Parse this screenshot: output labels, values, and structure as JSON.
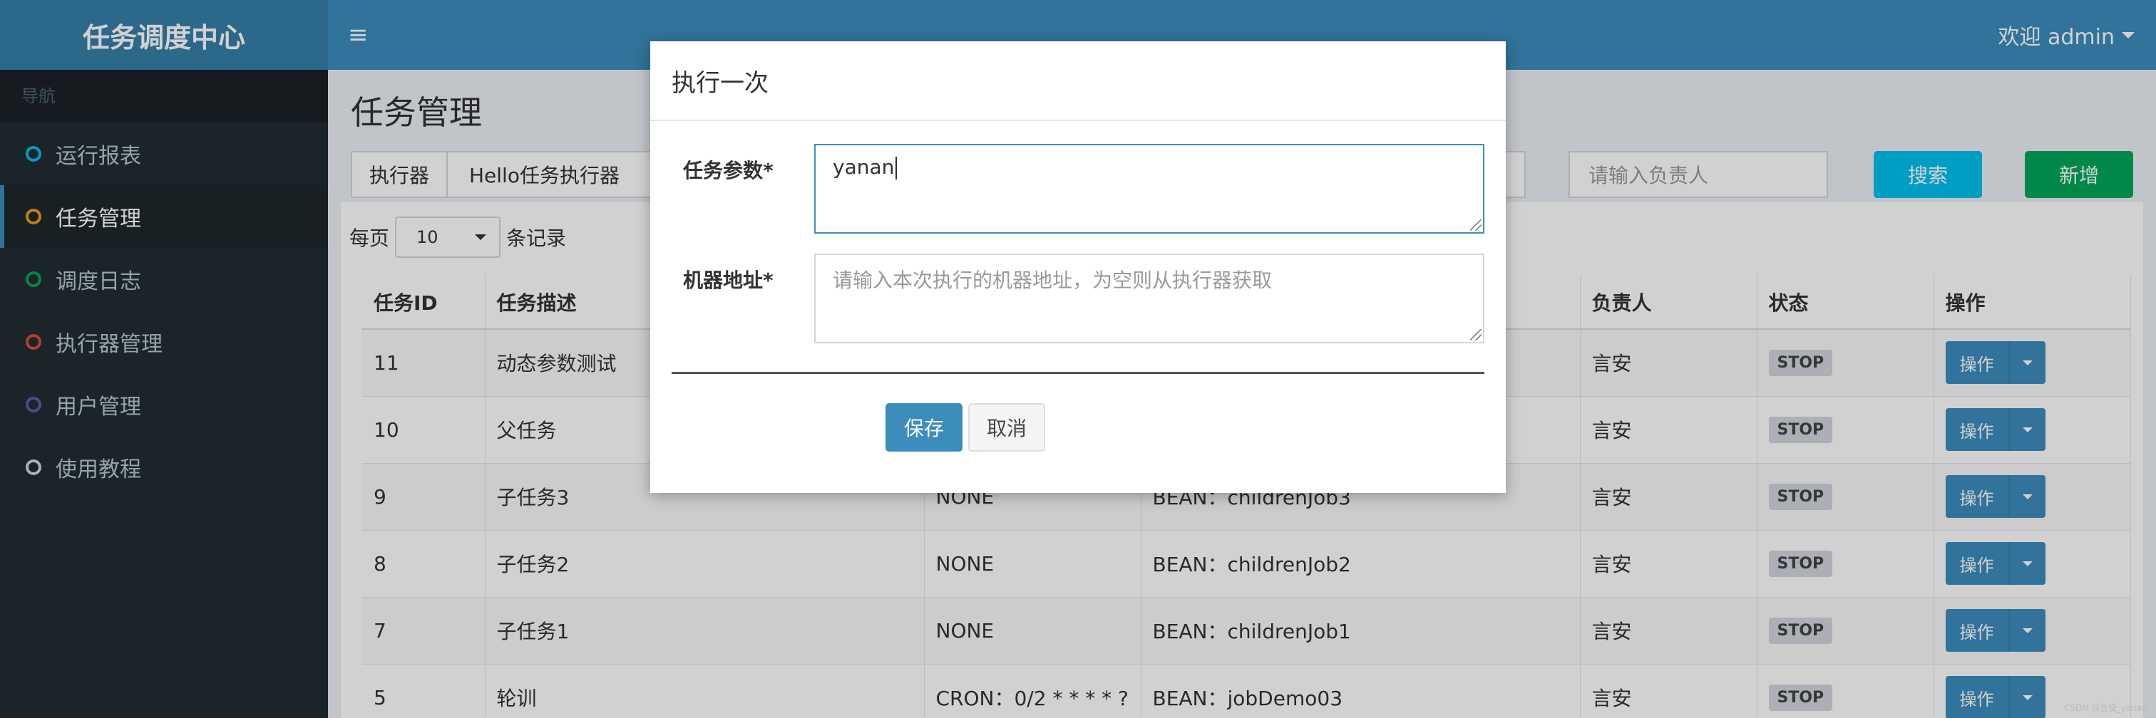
{
  "app": {
    "title": "任务调度中心",
    "hamburger": "≡",
    "user_label": "欢迎 admin"
  },
  "sidebar": {
    "header": "导航",
    "items": [
      {
        "label": "运行报表",
        "color": "#00c0ef",
        "active": false
      },
      {
        "label": "任务管理",
        "color": "#f39c12",
        "active": true
      },
      {
        "label": "调度日志",
        "color": "#00a65a",
        "active": false
      },
      {
        "label": "执行器管理",
        "color": "#dd4b39",
        "active": false
      },
      {
        "label": "用户管理",
        "color": "#605ca8",
        "active": false
      },
      {
        "label": "使用教程",
        "color": "#d2d6de",
        "active": false
      }
    ]
  },
  "main": {
    "title": "任务管理",
    "filter": {
      "executor_label": "执行器",
      "executor_value": "Hello任务执行器",
      "owner_placeholder": "请输入负责人",
      "search_label": "搜索",
      "add_label": "新增"
    },
    "page_size": {
      "prefix": "每页",
      "value": "10",
      "suffix": "条记录"
    },
    "table": {
      "columns": [
        "任务ID",
        "任务描述",
        "",
        "",
        "负责人",
        "状态",
        "操作"
      ],
      "rows": [
        {
          "id": "11",
          "desc": "动态参数测试",
          "schedule": "",
          "handler": "",
          "owner": "言安",
          "status": "STOP",
          "op": "操作"
        },
        {
          "id": "10",
          "desc": "父任务",
          "schedule": "",
          "handler": "",
          "owner": "言安",
          "status": "STOP",
          "op": "操作"
        },
        {
          "id": "9",
          "desc": "子任务3",
          "schedule": "NONE",
          "handler": "BEAN：childrenJob3",
          "owner": "言安",
          "status": "STOP",
          "op": "操作"
        },
        {
          "id": "8",
          "desc": "子任务2",
          "schedule": "NONE",
          "handler": "BEAN：childrenJob2",
          "owner": "言安",
          "status": "STOP",
          "op": "操作"
        },
        {
          "id": "7",
          "desc": "子任务1",
          "schedule": "NONE",
          "handler": "BEAN：childrenJob1",
          "owner": "言安",
          "status": "STOP",
          "op": "操作"
        },
        {
          "id": "5",
          "desc": "轮训",
          "schedule": "CRON：0/2 * * * * ?",
          "handler": "BEAN：jobDemo03",
          "owner": "言安",
          "status": "STOP",
          "op": "操作"
        }
      ]
    }
  },
  "modal": {
    "title": "执行一次",
    "param_label": "任务参数*",
    "param_value": "yanan",
    "address_label": "机器地址*",
    "address_placeholder": "请输入本次执行的机器地址，为空则从执行器获取",
    "save_label": "保存",
    "cancel_label": "取消"
  },
  "watermark": "CSDN @言安_yanan"
}
